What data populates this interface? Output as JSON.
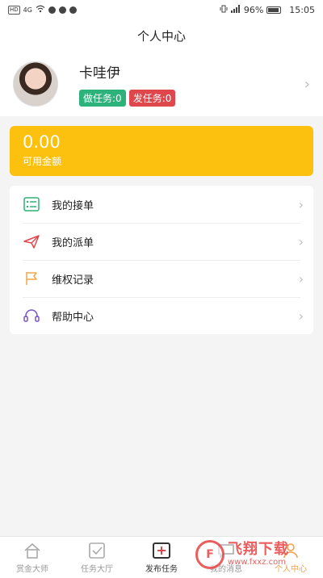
{
  "status_bar": {
    "left_chip": "HD",
    "signal": "4G",
    "battery_percent": "96%",
    "time": "15:05"
  },
  "header": {
    "title": "个人中心"
  },
  "profile": {
    "username": "卡哇伊",
    "do_tasks_label": "做任务:0",
    "post_tasks_label": "发任务:0",
    "colors": {
      "green": "#2db27c",
      "red": "#e0474c"
    }
  },
  "balance": {
    "amount": "0.00",
    "label": "可用金额",
    "color": "#fcc10f"
  },
  "menu": {
    "items": [
      {
        "label": "我的接单",
        "icon": "list-check-icon"
      },
      {
        "label": "我的派单",
        "icon": "paper-plane-icon"
      },
      {
        "label": "维权记录",
        "icon": "flag-icon"
      },
      {
        "label": "帮助中心",
        "icon": "headset-icon"
      }
    ]
  },
  "tabbar": {
    "tabs": [
      {
        "label": "赏金大师",
        "icon": "home-icon"
      },
      {
        "label": "任务大厅",
        "icon": "task-check-icon"
      },
      {
        "label": "发布任务",
        "icon": "add-task-icon"
      },
      {
        "label": "我的消息",
        "icon": "message-icon"
      },
      {
        "label": "个人中心",
        "icon": "user-icon"
      }
    ]
  },
  "watermark": {
    "logo_text": "F",
    "main": "飞翔下载",
    "sub": "www.fxxz.com"
  }
}
